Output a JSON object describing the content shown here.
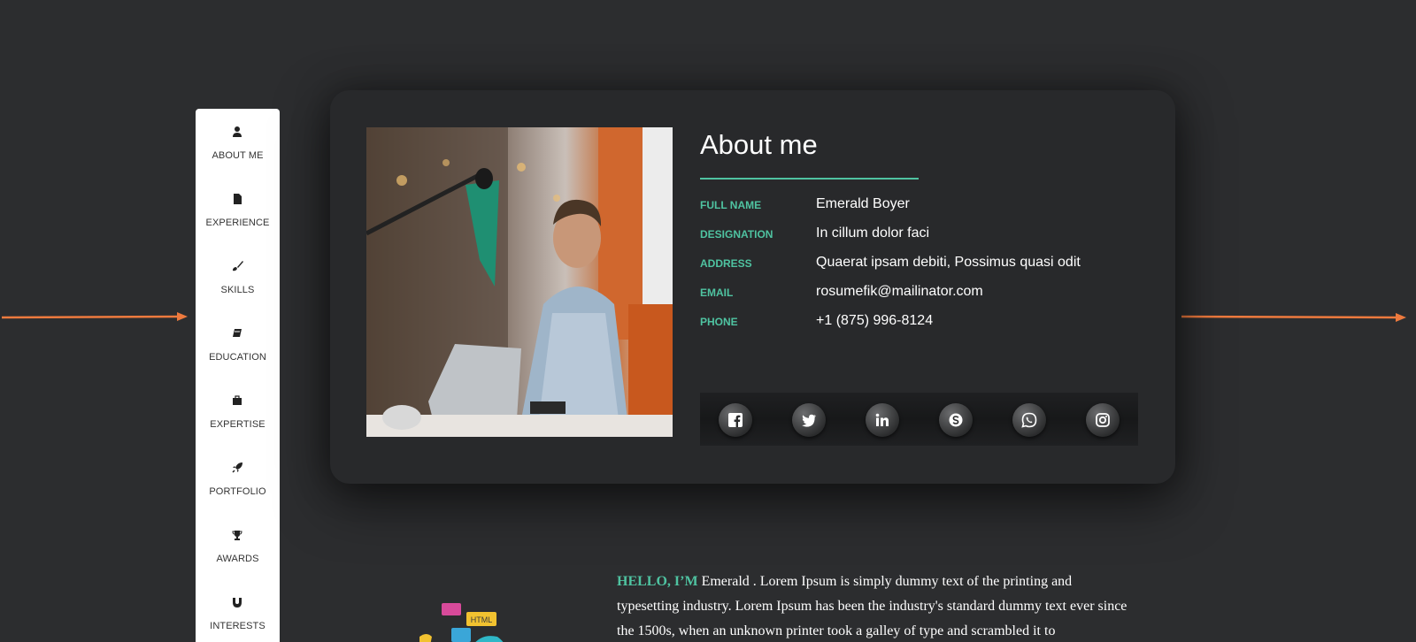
{
  "nav": {
    "items": [
      {
        "label": "ABOUT ME",
        "icon": "user-icon"
      },
      {
        "label": "EXPERIENCE",
        "icon": "file-icon"
      },
      {
        "label": "SKILLS",
        "icon": "paintbrush-icon"
      },
      {
        "label": "EDUCATION",
        "icon": "book-icon"
      },
      {
        "label": "EXPERTISE",
        "icon": "briefcase-icon"
      },
      {
        "label": "PORTFOLIO",
        "icon": "rocket-icon"
      },
      {
        "label": "AWARDS",
        "icon": "trophy-icon"
      },
      {
        "label": "INTERESTS",
        "icon": "magnet-icon"
      }
    ]
  },
  "about": {
    "title": "About me",
    "fields": [
      {
        "label": "FULL NAME",
        "value": "Emerald Boyer"
      },
      {
        "label": "DESIGNATION",
        "value": "In cillum dolor faci"
      },
      {
        "label": "ADDRESS",
        "value": "Quaerat ipsam debiti, Possimus quasi odit"
      },
      {
        "label": "EMAIL",
        "value": "rosumefik@mailinator.com"
      },
      {
        "label": "PHONE",
        "value": "+1 (875) 996-8124"
      }
    ],
    "social": [
      "facebook-icon",
      "twitter-icon",
      "linkedin-icon",
      "skype-icon",
      "whatsapp-icon",
      "instagram-icon"
    ]
  },
  "intro": {
    "hello": "HELLO, I’M",
    "text": " Emerald . Lorem Ipsum is simply dummy text of the printing and typesetting industry. Lorem Ipsum has been the industry's standard dummy text ever since the 1500s, when an unknown printer took a galley of type and scrambled it to",
    "illustration_badge": "HTML"
  },
  "colors": {
    "accent": "#4fc3a1",
    "arrow": "#ee7a3e",
    "background": "#2c2d2f",
    "card": "#28292b"
  }
}
